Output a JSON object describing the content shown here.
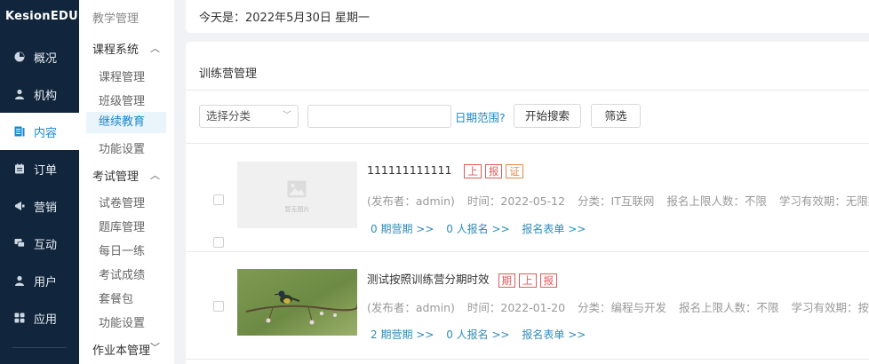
{
  "brand": "KesionEDU",
  "nav": [
    {
      "label": "概况",
      "icon": "dashboard-icon",
      "active": false
    },
    {
      "label": "机构",
      "icon": "person-icon",
      "active": false
    },
    {
      "label": "内容",
      "icon": "content-icon",
      "active": true
    },
    {
      "label": "订单",
      "icon": "order-icon",
      "active": false
    },
    {
      "label": "营销",
      "icon": "marketing-icon",
      "active": false
    },
    {
      "label": "互动",
      "icon": "chat-icon",
      "active": false
    },
    {
      "label": "用户",
      "icon": "user-icon",
      "active": false
    },
    {
      "label": "应用",
      "icon": "apps-icon",
      "active": false
    }
  ],
  "submenu": {
    "top": "教学管理",
    "course_group": "课程系统",
    "course_items": [
      "课程管理",
      "班级管理",
      "继续教育",
      "功能设置"
    ],
    "exam_group": "考试管理",
    "exam_items": [
      "试卷管理",
      "题库管理",
      "每日一练",
      "考试成绩",
      "套餐包",
      "功能设置"
    ],
    "homework_group": "作业本管理"
  },
  "date_text": "今天是：2022年5月30日 星期一",
  "section_title": "训练营管理",
  "filters": {
    "category_placeholder": "选择分类",
    "date_range_link": "日期范围?",
    "search_button": "开始搜索",
    "filter_button": "筛选"
  },
  "camps": [
    {
      "title": "111111111111",
      "tags": [
        "上",
        "报",
        "证"
      ],
      "publisher": "(发布者：admin)",
      "time": "时间：2022-05-12",
      "category": "分类：IT互联网",
      "limit": "报名上限人数：不限",
      "validity": "学习有效期：无限期",
      "links": [
        "0 期营期 >>",
        "0 人报名 >>",
        "报名表单 >>"
      ],
      "image": "placeholder",
      "placeholder_text": "暂无图片"
    },
    {
      "title": "测试按照训练营分期时效",
      "tags": [
        "期",
        "上",
        "报"
      ],
      "publisher": "(发布者：admin)",
      "time": "时间：2022-01-20",
      "category": "分类：编程与开发",
      "limit": "报名上限人数：不限",
      "validity": "学习有效期：按期",
      "links": [
        "2 期营期 >>",
        "0 人报名 >>",
        "报名表单 >>"
      ],
      "image": "bird-photo"
    }
  ],
  "colors": {
    "nav_bg": "#11263c",
    "accent": "#1e88c7",
    "tag_red": "#e05a5a",
    "tag_orange": "#e58a4b",
    "link": "#2f8bb8"
  }
}
